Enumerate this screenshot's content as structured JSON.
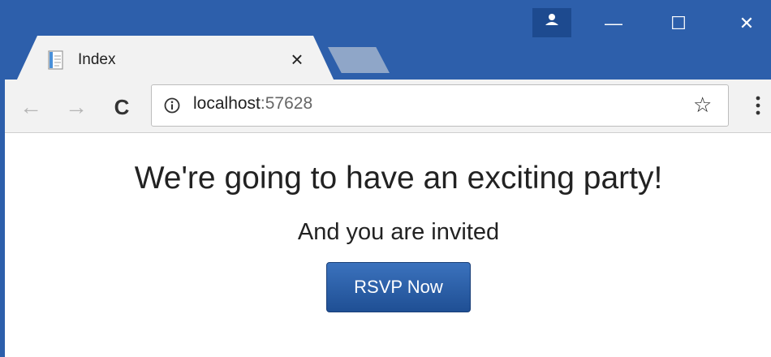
{
  "browser": {
    "tab": {
      "title": "Index",
      "close_glyph": "×",
      "favicon": "document-icon"
    },
    "window_controls": {
      "minimize": "—",
      "maximize": "☐",
      "close": "✕"
    },
    "toolbar": {
      "back_glyph": "←",
      "forward_glyph": "→",
      "reload_glyph": "C",
      "url_host": "localhost",
      "url_port": ":57628",
      "bookmark_glyph": "☆"
    },
    "colors": {
      "titlebar": "#2d5fab",
      "user_button": "#1d4a8f",
      "toolbar": "#f2f2f2",
      "rsvp_button_top": "#3b72bd",
      "rsvp_button_bottom": "#1f4f94"
    }
  },
  "page": {
    "heading": "We're going to have an exciting party!",
    "subheading": "And you are invited",
    "rsvp_label": "RSVP Now"
  }
}
